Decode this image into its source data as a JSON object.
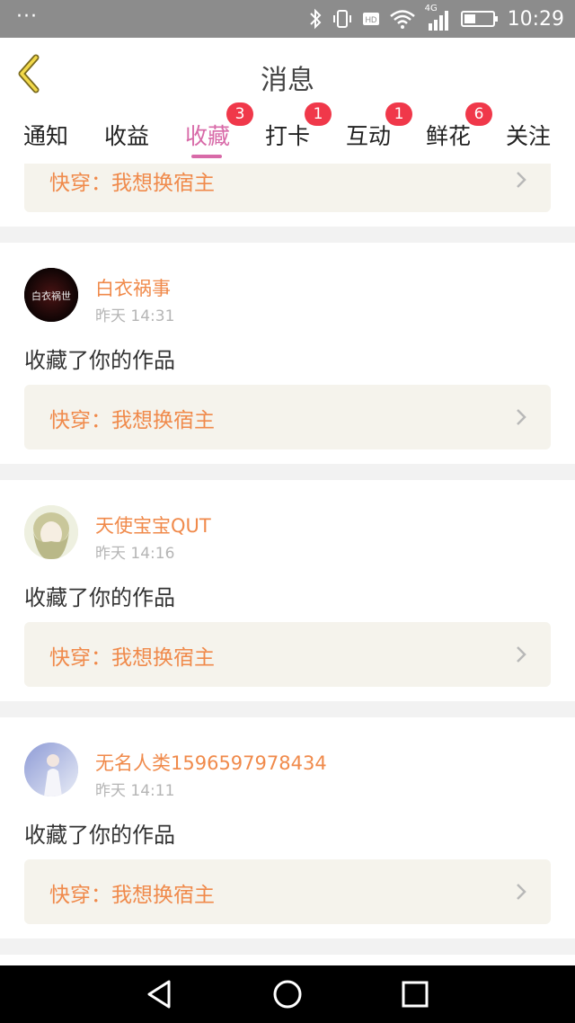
{
  "status_bar": {
    "dots": "···",
    "network": "4G",
    "time": "10:29"
  },
  "header": {
    "title": "消息"
  },
  "tabs": [
    {
      "label": "通知",
      "badge": ""
    },
    {
      "label": "收益",
      "badge": ""
    },
    {
      "label": "收藏",
      "badge": "3",
      "active": true
    },
    {
      "label": "打卡",
      "badge": "1"
    },
    {
      "label": "互动",
      "badge": "1"
    },
    {
      "label": "鲜花",
      "badge": "6"
    },
    {
      "label": "关注",
      "badge": ""
    }
  ],
  "partial_card": {
    "work_title": "快穿：我想换宿主"
  },
  "cards": [
    {
      "username": "白衣祸事",
      "time": "昨天 14:31",
      "action": "收藏了你的作品",
      "work_title": "快穿：我想换宿主",
      "avatar_text": "白衣祸世"
    },
    {
      "username": "天使宝宝QUT",
      "time": "昨天 14:16",
      "action": "收藏了你的作品",
      "work_title": "快穿：我想换宿主"
    },
    {
      "username": "无名人类1596597978434",
      "time": "昨天 14:11",
      "action": "收藏了你的作品",
      "work_title": "快穿：我想换宿主"
    }
  ],
  "colors": {
    "accent": "#d86aa8",
    "name": "#f08a4b",
    "badge": "#f0384a"
  }
}
